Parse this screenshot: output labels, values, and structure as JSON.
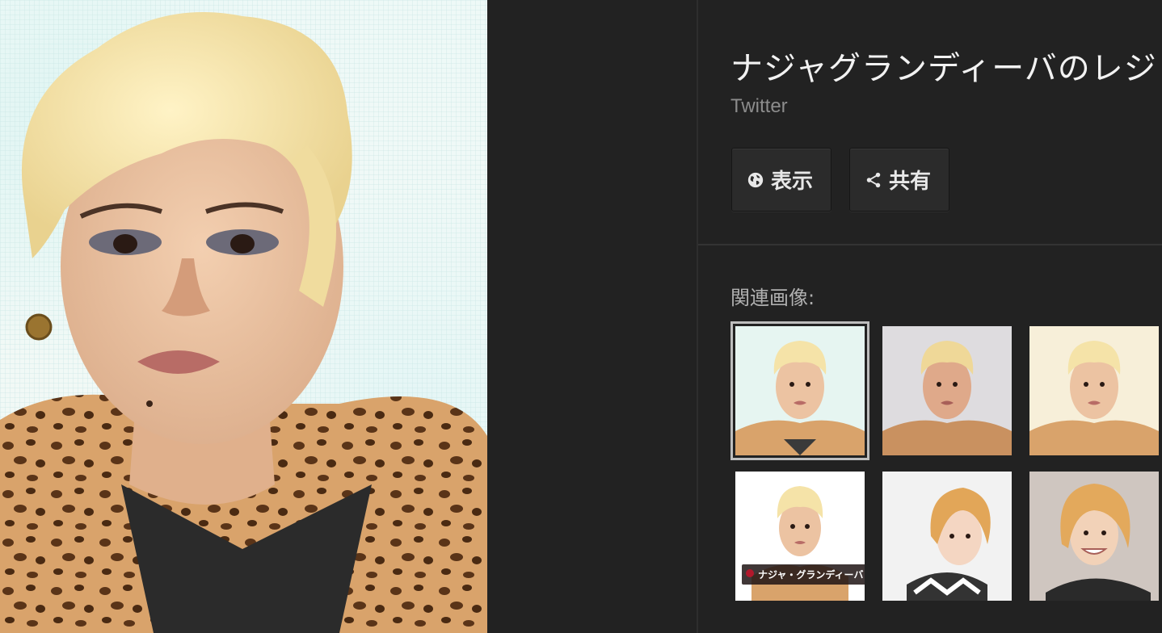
{
  "detail": {
    "title": "ナジャグランディーバのレジ",
    "source": "Twitter"
  },
  "actions": {
    "view_label": "表示",
    "share_label": "共有"
  },
  "related": {
    "label": "関連画像:",
    "items": [
      {
        "kind": "blonde-leopard",
        "bg": "#e6f5f1",
        "selected": true,
        "caption": ""
      },
      {
        "kind": "blonde-leopard",
        "bg": "#dedcdf",
        "selected": false,
        "caption": ""
      },
      {
        "kind": "blonde-leopard",
        "bg": "#f7efd9",
        "selected": false,
        "caption": ""
      },
      {
        "kind": "blonde-leopard",
        "bg": "#ffffff",
        "selected": false,
        "caption": "ナジャ・グランディーバ"
      },
      {
        "kind": "young-woman",
        "bg": "#f2f2f2",
        "selected": false,
        "caption": ""
      },
      {
        "kind": "young-woman-smile",
        "bg": "#cfc6c0",
        "selected": false,
        "caption": ""
      }
    ]
  },
  "colors": {
    "background": "#222222",
    "button": "#2b2b2b",
    "muted_text": "#8c8c8c"
  },
  "icons": {
    "view": "globe-icon",
    "share": "share-icon"
  }
}
